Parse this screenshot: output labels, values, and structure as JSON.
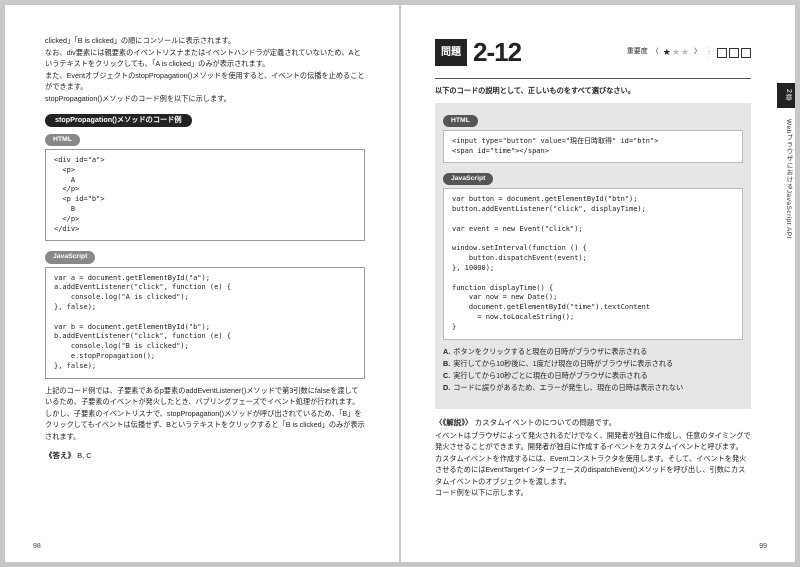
{
  "left": {
    "intro": "clicked」「B is clicked」の順にコンソールに表示されます。\nなお、div要素には親要素のイベントリスナまたはイベントハンドラが定義されていないため、Aというテキストをクリックしても、「A is clicked」のみが表示されます。\nまた、EventオブジェクトのstopPropagation()メソッドを使用すると、イベントの伝播を止めることができます。\nstopPropagation()メソッドのコード例を以下に示します。",
    "heading_main": "stopPropagation()メソッドのコード例",
    "label_html": "HTML",
    "code_html": "<div id=\"a\">\n  <p>\n    A\n  </p>\n  <p id=\"b\">\n    B\n  </p>\n</div>",
    "label_js": "JavaScript",
    "code_js": "var a = document.getElementById(\"a\");\na.addEventListener(\"click\", function (e) {\n    console.log(\"A is clicked\");\n}, false);\n\nvar b = document.getElementById(\"b\");\nb.addEventListener(\"click\", function (e) {\n    console.log(\"B is clicked\");\n    e.stopPropagation();\n}, false);",
    "after_code": "上記のコード例では、子要素であるp要素のaddEventListener()メソッドで第3引数にfalseを渡しているため、子要素のイベントが発火したとき、バブリングフェーズでイベント処理が行われます。しかし、子要素のイベントリスナで、stopPropagation()メソッドが呼び出されているため、「B」をクリックしてもイベントは伝播せず、Bというテキストをクリックすると「B is clicked」のみが表示されます。",
    "answer_label": "《答え》",
    "answer_value": "B, C",
    "page_num": "98"
  },
  "right": {
    "q_label": "問題",
    "q_num": "2-12",
    "importance_label": "重要度",
    "stars_on": 1,
    "stars_total": 3,
    "side_tab": "2章",
    "side_label": "WebブラウザにおけるJavaScript API",
    "stem": "以下のコードの説明として、正しいものをすべて選びなさい。",
    "label_html": "HTML",
    "code_html": "<input type=\"button\" value=\"現在日時取得\" id=\"btn\">\n<span id=\"time\"></span>",
    "label_js": "JavaScript",
    "code_js": "var button = document.getElementById(\"btn\");\nbutton.addEventListener(\"click\", displayTime);\n\nvar event = new Event(\"click\");\n\nwindow.setInterval(function () {\n    button.dispatchEvent(event);\n}, 10000);\n\nfunction displayTime() {\n    var now = new Date();\n    document.getElementById(\"time\").textContent\n      = now.toLocaleString();\n}",
    "choices": {
      "A": "ボタンをクリックすると現在の日時がブラウザに表示される",
      "B": "実行してから10秒後に、1度だけ現在の日時がブラウザに表示される",
      "C": "実行してから10秒ごとに現在の日時がブラウザに表示される",
      "D": "コードに誤りがあるため、エラーが発生し、現在の日時は表示されない"
    },
    "explain_heading": "解説",
    "explain_lead": "カスタムイベントのについての問題です。",
    "explain_body": "イベントはブラウザによって発火されるだけでなく、開発者が独自に作成し、任意のタイミングで発火させることができます。開発者が独自に作成するイベントをカスタムイベントと呼びます。\nカスタムイベントを作成するには、Eventコンストラクタを使用します。そして、イベントを発火させるためにはEventTargetインターフェースのdispatchEvent()メソッドを呼び出し、引数にカスタムイベントのオブジェクトを渡します。\nコード例を以下に示します。",
    "page_num": "99"
  }
}
